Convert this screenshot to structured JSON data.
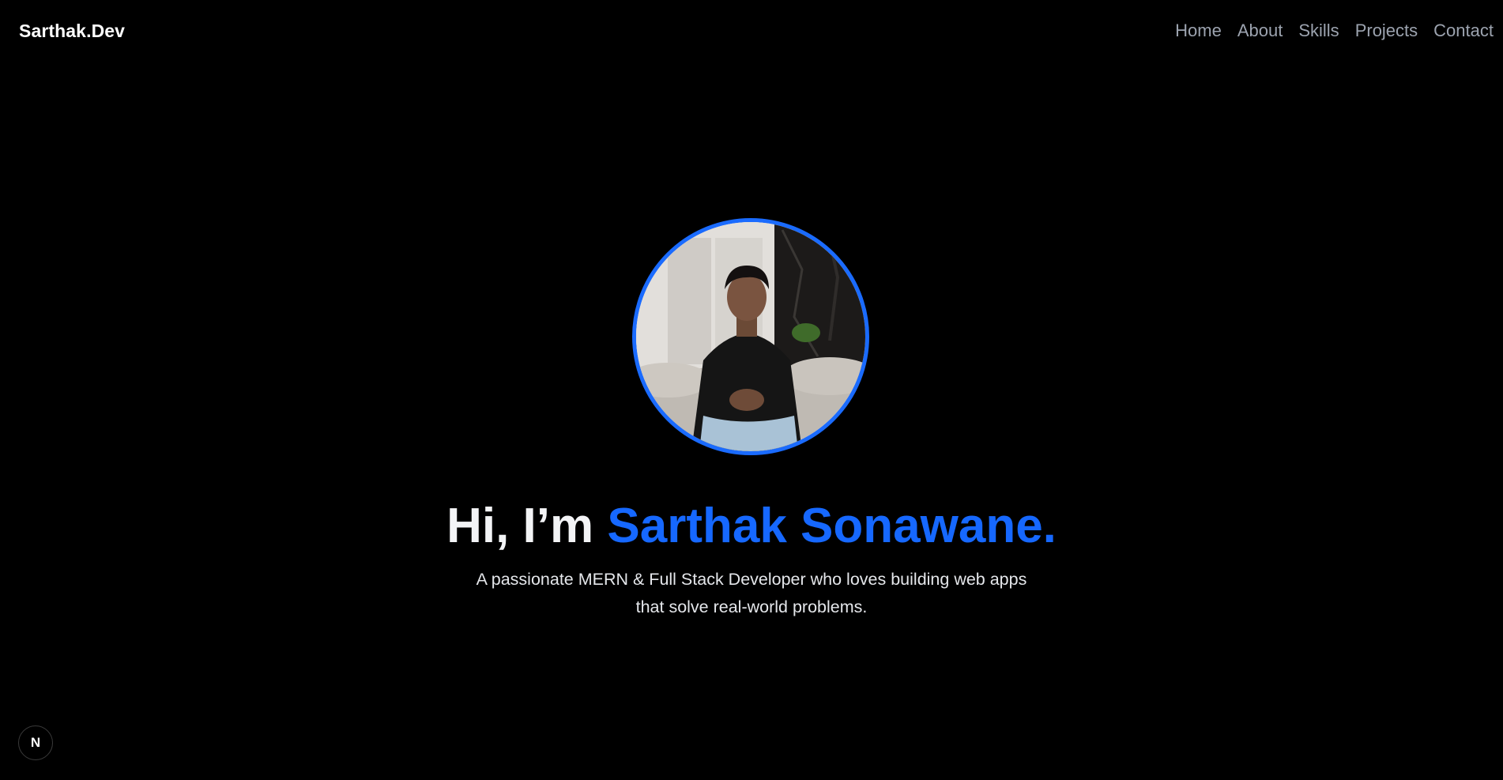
{
  "header": {
    "brand": "Sarthak.Dev",
    "nav": [
      "Home",
      "About",
      "Skills",
      "Projects",
      "Contact"
    ]
  },
  "hero": {
    "greeting": "Hi, I’m ",
    "name": "Sarthak Sonawane.",
    "subtitle": "A passionate MERN & Full Stack Developer who loves building web apps that solve real-world problems.",
    "avatar_icon": "profile-photo"
  },
  "dev_indicator": {
    "label": "N",
    "icon": "nextjs-icon"
  },
  "colors": {
    "background": "#000000",
    "accent": "#1668ff",
    "avatar_border": "#1a6bff",
    "nav_text": "#9ca3af"
  }
}
